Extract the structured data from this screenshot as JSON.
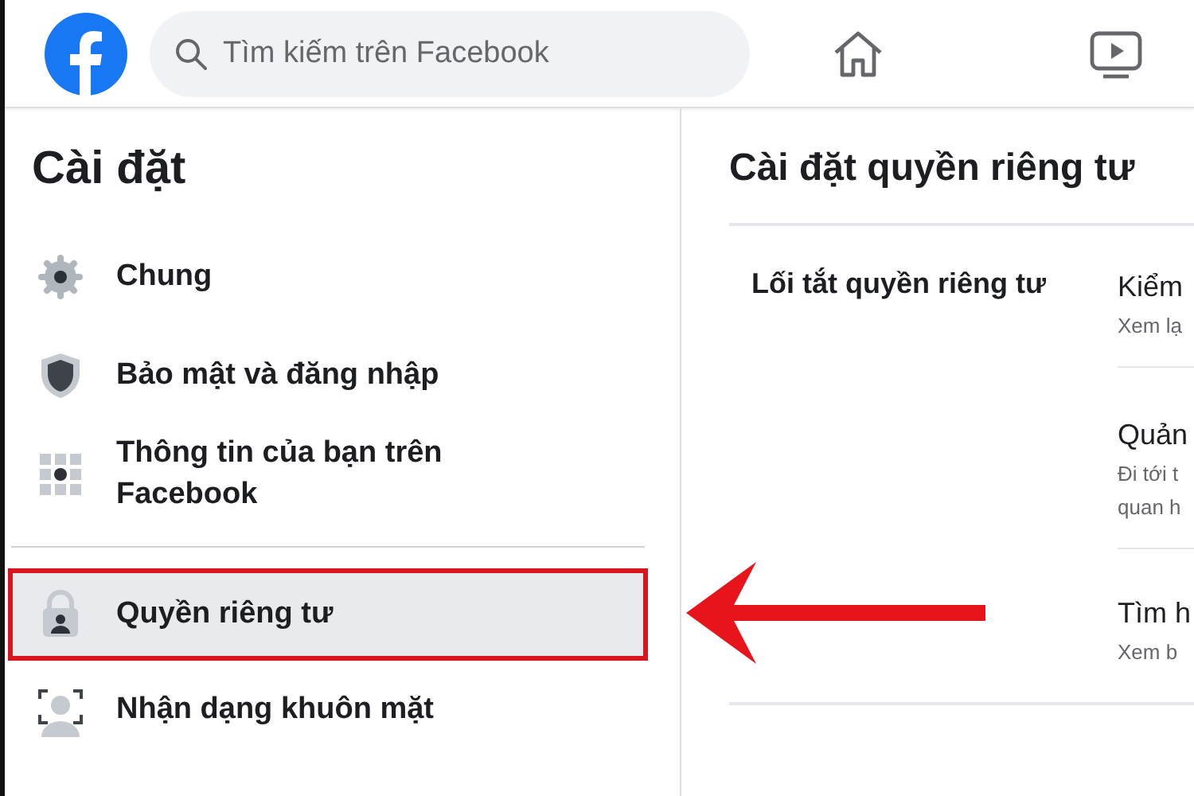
{
  "top_bar": {
    "search": {
      "placeholder": "Tìm kiếm trên Facebook"
    },
    "nav_icons": [
      {
        "kind": "home"
      },
      {
        "kind": "video"
      }
    ]
  },
  "sidebar": {
    "title": "Cài đặt",
    "items": [
      {
        "kind": "gear",
        "label": "Chung",
        "selected": false,
        "divider_before": false
      },
      {
        "kind": "shield",
        "label": "Bảo mật và đăng nhập",
        "selected": false,
        "divider_before": false
      },
      {
        "kind": "grid",
        "label": "Thông tin của bạn trên Facebook",
        "selected": false,
        "divider_before": false
      },
      {
        "kind": "lock",
        "label": "Quyền riêng tư",
        "selected": true,
        "divider_before": true
      },
      {
        "kind": "face",
        "label": "Nhận dạng khuôn mặt",
        "selected": false,
        "divider_before": false
      }
    ]
  },
  "content": {
    "title": "Cài đặt quyền riêng tư",
    "sections": [
      {
        "heading": "Lối tắt quyền riêng tư",
        "items": [
          {
            "title": "Kiểm",
            "lines": [
              "Xem lạ"
            ]
          },
          {
            "title": "Quản",
            "lines": [
              "Đi tới t",
              "quan h"
            ]
          },
          {
            "title": "Tìm h",
            "lines": [
              "Xem b"
            ]
          }
        ]
      }
    ]
  },
  "annotation": {
    "kind": "arrow"
  }
}
